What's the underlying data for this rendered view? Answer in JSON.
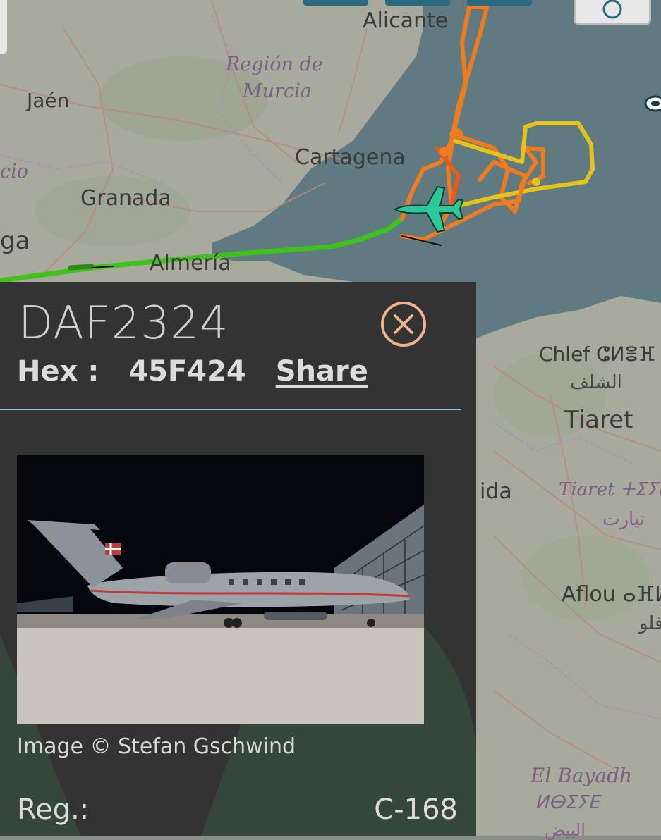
{
  "map": {
    "labels": {
      "alicante": "Alicante",
      "region_murcia_1": "Región de",
      "region_murcia_2": "Murcia",
      "jaen": "Jaén",
      "cartagena": "Cartagena",
      "granada": "Granada",
      "almeria": "Almería",
      "ga": "ga",
      "cio": "cio",
      "chlef": "Chlef ⵛⵍⴻⴼ",
      "chlef_ar": "الشلف",
      "tiaret": "Tiaret",
      "tiaret_tz": "Tiaret ⵜⵉⵢⴰ",
      "tiaret_ar": "تيارت",
      "ida": "ida",
      "aflou": "Aflou ⴰⴼⵍ",
      "aflou_ar": "أفلو",
      "el_bayadh": "El Bayadh",
      "el_bayadh_tz": "ⵍⴱⵉⵢⴹ",
      "el_bayadh_ar": "البيض"
    },
    "colors": {
      "land": "#a7aa9c",
      "sea": "#5f7a80",
      "track_green": "#3fc21b",
      "track_orange": "#f07a1e",
      "track_yellow": "#e6c21c",
      "aircraft": "#2ec79a"
    },
    "icons": {
      "aircraft": "plane-icon",
      "layers": "layers-icon"
    }
  },
  "panel": {
    "callsign": "DAF2324",
    "hex_label": "Hex :",
    "hex_value": "45F424",
    "share_label": "Share",
    "close_icon": "close-circle-icon",
    "photo_alt": "Aircraft photo",
    "photo_credit": "Image © Stefan Gschwind",
    "reg_label": "Reg.:",
    "reg_value": "C-168",
    "accent": "#f0b48c",
    "divider_color": "#9ac3cf"
  }
}
